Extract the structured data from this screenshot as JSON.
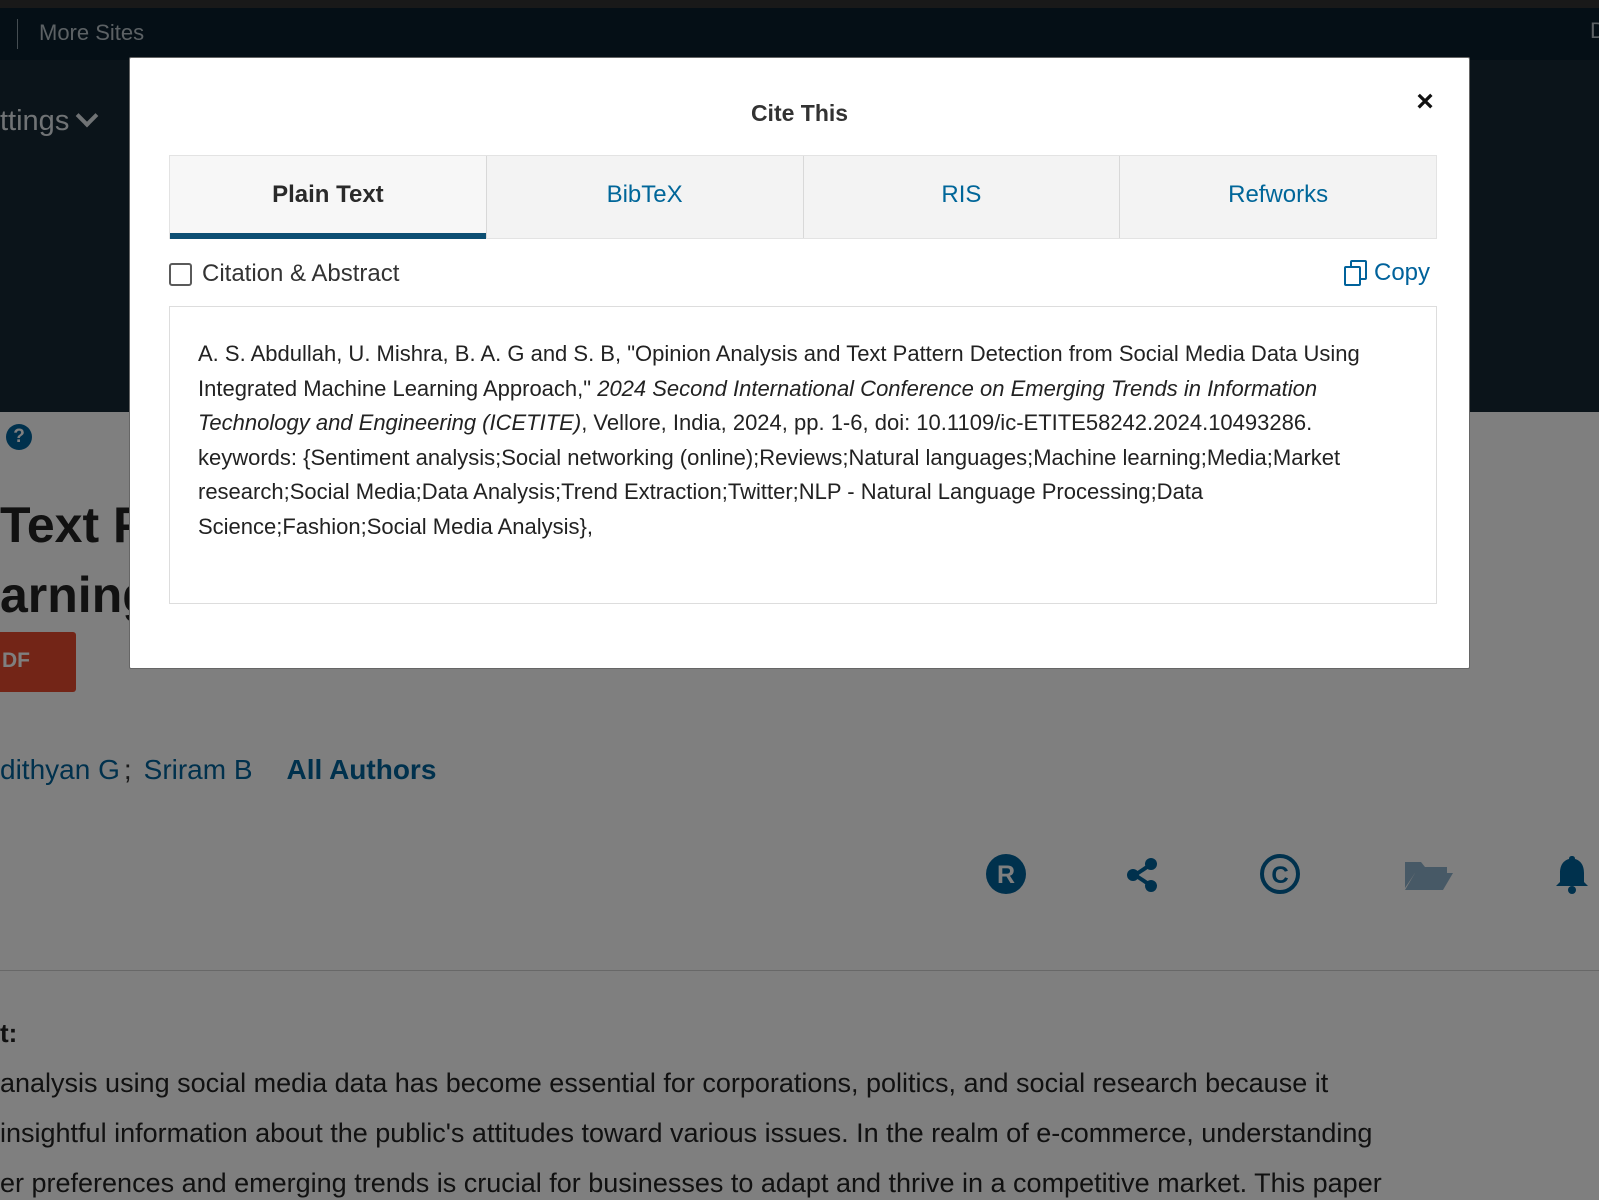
{
  "site_bar": {
    "more_sites": "More Sites",
    "edge_glyph": "D"
  },
  "header": {
    "settings_label": "ttings"
  },
  "document": {
    "help_icon_glyph": "?",
    "title_fragment_1": "Text P",
    "title_fragment_2": "arning",
    "pdf_label": "DF",
    "authors": [
      "dithyan G",
      "Sriram B"
    ],
    "author_separator": ";",
    "all_authors_label": "All Authors",
    "action_icons": [
      "rights-icon",
      "share-icon",
      "copyright-icon",
      "folder-icon",
      "bell-icon"
    ],
    "abstract_label": "t:",
    "abstract_lines": [
      "analysis using social media data has become essential for corporations, politics, and social research because it",
      " insightful information about the public's attitudes toward various issues. In the realm of e-commerce, understanding",
      "er preferences and emerging trends is crucial for businesses to adapt and thrive in a competitive market. This paper"
    ]
  },
  "modal": {
    "title": "Cite This",
    "close_glyph": "×",
    "tabs": [
      {
        "label": "Plain Text",
        "active": true
      },
      {
        "label": "BibTeX",
        "active": false
      },
      {
        "label": "RIS",
        "active": false
      },
      {
        "label": "Refworks",
        "active": false
      }
    ],
    "checkbox_label": "Citation & Abstract",
    "checkbox_checked": false,
    "copy_label": "Copy",
    "citation": {
      "authors_and_title": "A. S. Abdullah, U. Mishra, B. A. G and S. B, \"Opinion Analysis and Text Pattern Detection from Social Media Data Using Integrated Machine Learning Approach,\" ",
      "venue": "2024 Second International Conference on Emerging Trends in Information Technology and Engineering (ICETITE)",
      "details": ", Vellore, India, 2024, pp. 1-6, doi: 10.1109/ic-ETITE58242.2024.10493286.",
      "keywords": "keywords: {Sentiment analysis;Social networking (online);Reviews;Natural languages;Machine learning;Media;Market research;Social Media;Data Analysis;Trend Extraction;Twitter;NLP - Natural Language Processing;Data Science;Fashion;Social Media Analysis},"
    }
  },
  "colors": {
    "link": "#00629b",
    "active_tab_underline": "#0d4f73",
    "pdf_button": "#e64a2e",
    "site_bar": "#0a1f2c",
    "hero": "#162834"
  }
}
